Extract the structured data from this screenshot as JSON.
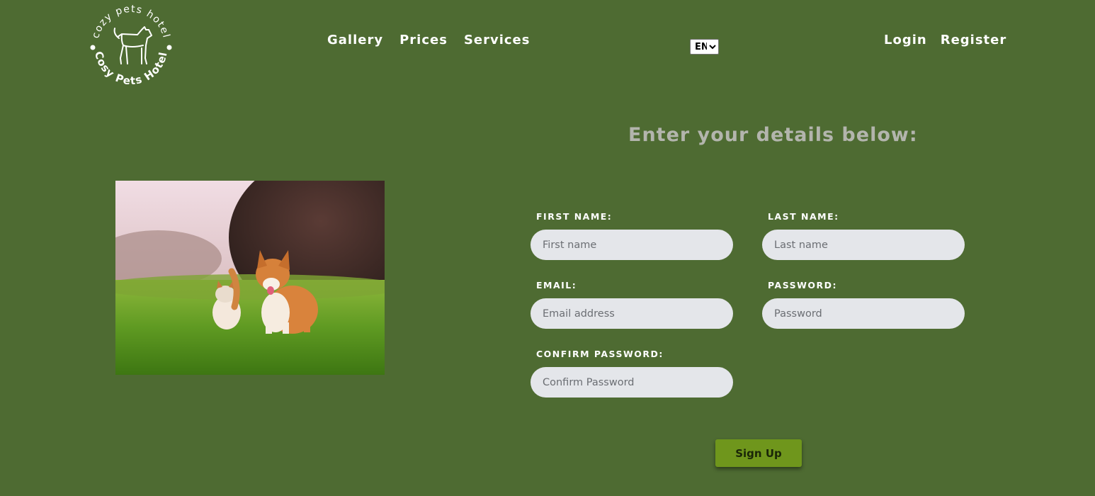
{
  "brand": {
    "logo_text_top": "cozy pets hotel",
    "logo_text_bottom": "Cosy Pets Hotel"
  },
  "nav": {
    "items": [
      {
        "label": "Gallery"
      },
      {
        "label": "Prices"
      },
      {
        "label": "Services"
      }
    ]
  },
  "language": {
    "selected": "EN"
  },
  "auth": {
    "login_label": "Login",
    "register_label": "Register"
  },
  "form": {
    "heading": "Enter your details below:",
    "first_name": {
      "label": "FIRST NAME:",
      "placeholder": "First name",
      "value": ""
    },
    "last_name": {
      "label": "LAST NAME:",
      "placeholder": "Last name",
      "value": ""
    },
    "email": {
      "label": "EMAIL:",
      "placeholder": "Email address",
      "value": ""
    },
    "password": {
      "label": "PASSWORD:",
      "placeholder": "Password",
      "value": ""
    },
    "confirm_password": {
      "label": "CONFIRM PASSWORD:",
      "placeholder": "Confirm Password",
      "value": ""
    },
    "submit_label": "Sign Up"
  },
  "colors": {
    "background": "#4e6b32",
    "heading": "#b3b5ad",
    "input_background": "#e4e6ea",
    "button": "#6f961c"
  },
  "hero_image": {
    "icon": "cat-and-corgi-photo"
  }
}
